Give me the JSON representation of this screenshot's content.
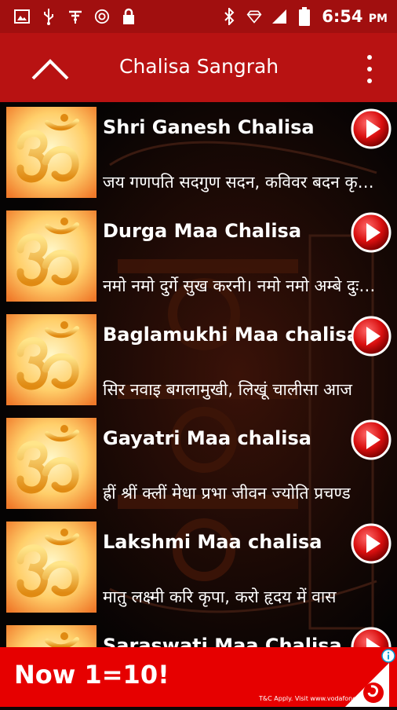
{
  "status_bar": {
    "time": "6:54",
    "ampm": "PM",
    "icons_left": [
      "gallery-icon",
      "usb-icon",
      "wifi-settings-icon",
      "at-sign-icon",
      "lock-icon"
    ],
    "icons_right": [
      "bluetooth-icon",
      "diamond-icon",
      "signal-icon",
      "battery-icon"
    ]
  },
  "toolbar": {
    "title": "Chalisa Sangrah",
    "up_icon": "chevron-up-icon",
    "menu_icon": "more-vert-icon"
  },
  "list": {
    "items": [
      {
        "title": "Shri Ganesh Chalisa",
        "subtitle": "जय गणपति सदगुण सदन, कविवर बदन कृपाल"
      },
      {
        "title": "Durga Maa Chalisa",
        "subtitle": "नमो नमो दुर्गे सुख करनी। नमो नमो अम्बे दुःख हरनी"
      },
      {
        "title": "Baglamukhi Maa chalisa",
        "subtitle": "सिर नवाइ बगलामुखी, लिखूं चालीसा आज"
      },
      {
        "title": "Gayatri Maa chalisa",
        "subtitle": "ह्रीं श्रीं क्लीं मेधा प्रभा जीवन ज्योति प्रचण्ड"
      },
      {
        "title": "Lakshmi Maa chalisa",
        "subtitle": "मातु लक्ष्मी करि कृपा, करो हृदय में वास"
      },
      {
        "title": "Saraswati Maa Chalisa",
        "subtitle": ""
      }
    ]
  },
  "ad": {
    "headline": "Now 1=10!",
    "terms": "T&C Apply. Visit www.vodafone.in",
    "brand_color": "#e60000"
  },
  "colors": {
    "status_bar": "#a10f0f",
    "toolbar": "#b81212",
    "background": "#050303",
    "play_button": "#e01414"
  }
}
